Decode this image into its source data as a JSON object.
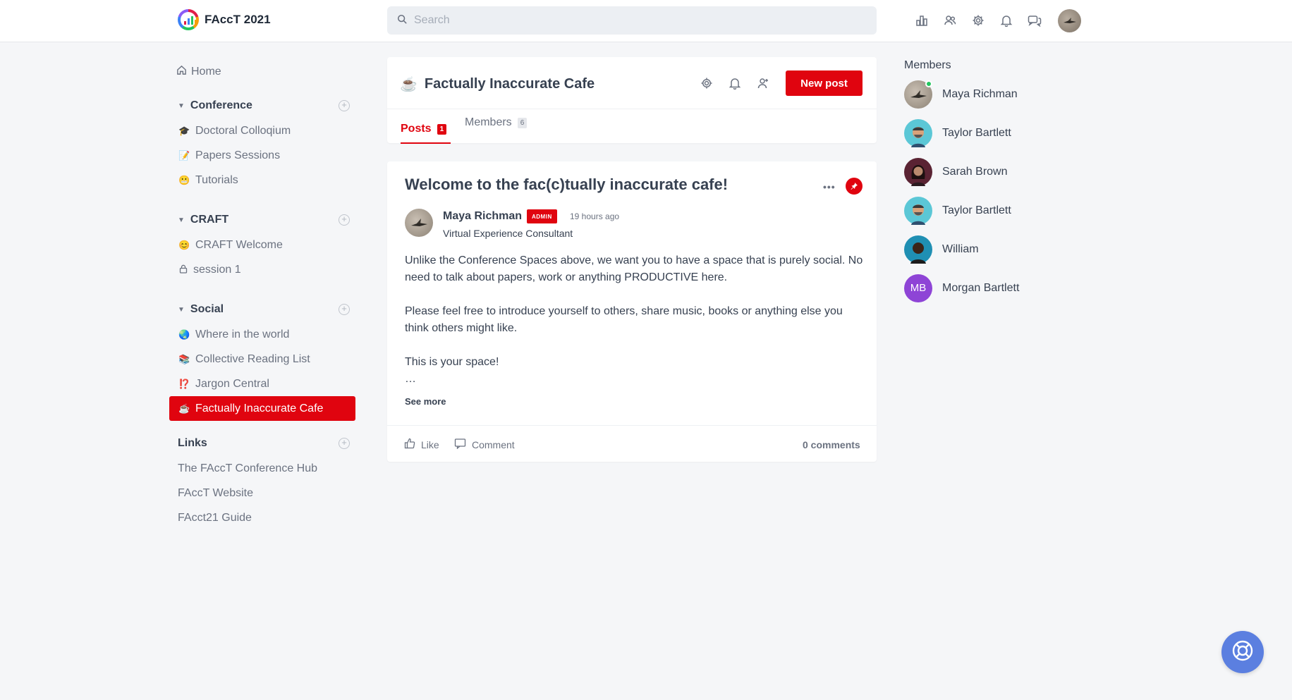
{
  "app": {
    "name": "FAccT 2021"
  },
  "search": {
    "placeholder": "Search"
  },
  "sidebar": {
    "home_label": "Home",
    "groups": [
      {
        "title": "Conference",
        "items": [
          {
            "emoji": "🎓",
            "label": "Doctoral Colloqium"
          },
          {
            "emoji": "📝",
            "label": "Papers Sessions"
          },
          {
            "emoji": "😬",
            "label": "Tutorials"
          }
        ]
      },
      {
        "title": "CRAFT",
        "items": [
          {
            "emoji": "😊",
            "label": "CRAFT Welcome"
          },
          {
            "emoji": "lock-icon",
            "label": "session 1"
          }
        ]
      },
      {
        "title": "Social",
        "items": [
          {
            "emoji": "🌏",
            "label": "Where in the world"
          },
          {
            "emoji": "📚",
            "label": "Collective Reading List"
          },
          {
            "emoji": "⁉️",
            "label": "Jargon Central"
          },
          {
            "emoji": "☕",
            "label": "Factually Inaccurate Cafe",
            "active": true
          }
        ]
      }
    ],
    "links_title": "Links",
    "links": [
      "The FAccT Conference Hub",
      "FAccT Website",
      "FAcct21 Guide"
    ]
  },
  "space": {
    "emoji": "☕",
    "title": "Factually Inaccurate Cafe",
    "new_post_label": "New post",
    "tabs": [
      {
        "label": "Posts",
        "count": "1",
        "active": true
      },
      {
        "label": "Members",
        "count": "6"
      }
    ]
  },
  "post": {
    "title": "Welcome to the fac(c)tually inaccurate cafe!",
    "author": "Maya Richman",
    "author_badge": "ADMIN",
    "time": "19 hours ago",
    "author_role": "Virtual Experience Consultant",
    "paragraphs": [
      "Unlike the Conference Spaces above, we want you to have a space that is purely social. No need to talk about papers, work or anything PRODUCTIVE here.",
      "Please feel free to introduce yourself to others, share music, books or anything else you think others might like.",
      "This is your space!"
    ],
    "ellipsis": "…",
    "see_more": "See more",
    "like_label": "Like",
    "comment_label": "Comment",
    "comments_count": "0 comments"
  },
  "members_panel": {
    "title": "Members",
    "list": [
      {
        "name": "Maya Richman",
        "initials": "",
        "color": "#a59a8c",
        "online": true
      },
      {
        "name": "Taylor Bartlett",
        "initials": "",
        "color": "#5bc7d6"
      },
      {
        "name": "Sarah Brown",
        "initials": "",
        "color": "#5a2333"
      },
      {
        "name": "Taylor Bartlett",
        "initials": "",
        "color": "#5bc7d6"
      },
      {
        "name": "William",
        "initials": "",
        "color": "#1f8fb3"
      },
      {
        "name": "Morgan Bartlett",
        "initials": "MB",
        "color": "#8e44d6"
      }
    ]
  },
  "colors": {
    "accent": "#e0040f",
    "help_button": "#5b7fe0"
  }
}
